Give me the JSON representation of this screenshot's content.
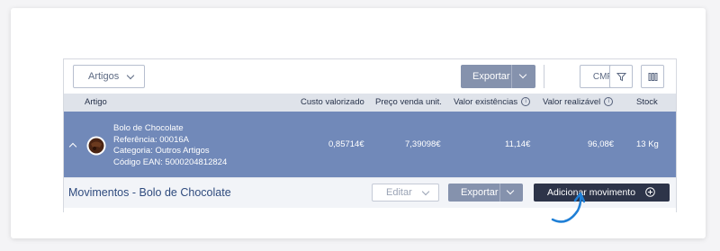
{
  "toolbar": {
    "artigos_select": "Artigos",
    "exportar_label": "Exportar",
    "cmp_label": "CMP"
  },
  "table": {
    "headers": {
      "artigo": "Artigo",
      "custo": "Custo valorizado",
      "preco": "Preço venda unit.",
      "valor_exist": "Valor existências",
      "valor_real": "Valor realizável",
      "stock": "Stock"
    }
  },
  "item": {
    "name": "Bolo de Chocolate",
    "referencia": "Referência: 00016A",
    "categoria": "Categoria: Outros Artigos",
    "ean": "Código EAN: 5000204812824",
    "custo": "0,85714€",
    "preco": "7,39098€",
    "valor_exist": "11,14€",
    "valor_real": "96,08€",
    "stock": "13 Kg"
  },
  "movimentos": {
    "title": "Movimentos - Bolo de Chocolate",
    "editar_label": "Editar",
    "exportar_label": "Exportar",
    "adicionar_label": "Adicionar movimento"
  },
  "colors": {
    "row_highlight": "#7189b9",
    "dark_button": "#2d3449",
    "arrow": "#1f7fd6"
  },
  "icons": [
    "chevron-down-icon",
    "filter-icon",
    "columns-icon",
    "info-icon",
    "chevron-up-icon",
    "cake-thumbnail",
    "plus-circle-icon",
    "curved-arrow-icon"
  ]
}
